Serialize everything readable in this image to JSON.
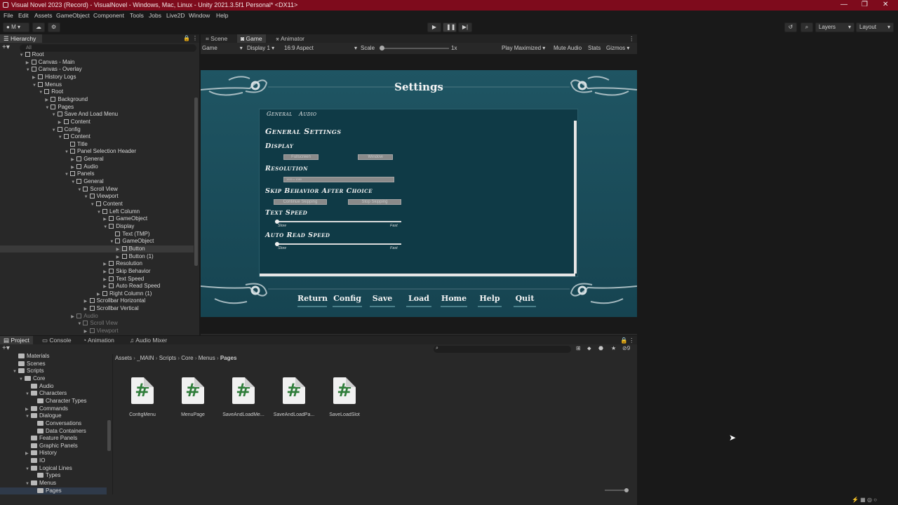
{
  "window": {
    "title": "Visual Novel 2023 (Record) - VisualNovel - Windows, Mac, Linux - Unity 2021.3.5f1 Personal* <DX11>",
    "minimize": "—",
    "restore": "❐",
    "close": "✕"
  },
  "menu": [
    "File",
    "Edit",
    "Assets",
    "GameObject",
    "Component",
    "Tools",
    "Jobs",
    "Live2D",
    "Window",
    "Help"
  ],
  "toolbar": {
    "account": "M",
    "play_icon": "play-icon",
    "pause_icon": "pause-icon",
    "step_icon": "step-icon",
    "layers": "Layers",
    "layout": "Layout"
  },
  "hierarchy": {
    "tab": "Hierarchy",
    "search_placeholder": "All",
    "rows": [
      {
        "label": "Root",
        "depth": 3,
        "arrow": "▼",
        "cut": true
      },
      {
        "label": "Canvas - Main",
        "depth": 4,
        "arrow": "▶"
      },
      {
        "label": "Canvas - Overlay",
        "depth": 4,
        "arrow": "▼"
      },
      {
        "label": "History Logs",
        "depth": 5,
        "arrow": "▶"
      },
      {
        "label": "Menus",
        "depth": 5,
        "arrow": "▼"
      },
      {
        "label": "Root",
        "depth": 6,
        "arrow": "▼"
      },
      {
        "label": "Background",
        "depth": 7,
        "arrow": "▶"
      },
      {
        "label": "Pages",
        "depth": 7,
        "arrow": "▼"
      },
      {
        "label": "Save And Load Menu",
        "depth": 8,
        "arrow": "▼"
      },
      {
        "label": "Content",
        "depth": 9,
        "arrow": "▶"
      },
      {
        "label": "Config",
        "depth": 8,
        "arrow": "▼"
      },
      {
        "label": "Content",
        "depth": 9,
        "arrow": "▼"
      },
      {
        "label": "Title",
        "depth": 10,
        "arrow": ""
      },
      {
        "label": "Panel Selection Header",
        "depth": 10,
        "arrow": "▼"
      },
      {
        "label": "General",
        "depth": 11,
        "arrow": "▶"
      },
      {
        "label": "Audio",
        "depth": 11,
        "arrow": "▶"
      },
      {
        "label": "Panels",
        "depth": 10,
        "arrow": "▼"
      },
      {
        "label": "General",
        "depth": 11,
        "arrow": "▼"
      },
      {
        "label": "Scroll View",
        "depth": 12,
        "arrow": "▼"
      },
      {
        "label": "Viewport",
        "depth": 13,
        "arrow": "▼"
      },
      {
        "label": "Content",
        "depth": 14,
        "arrow": "▼"
      },
      {
        "label": "Left Column",
        "depth": 15,
        "arrow": "▼"
      },
      {
        "label": "GameObject",
        "depth": 16,
        "arrow": "▶"
      },
      {
        "label": "Display",
        "depth": 16,
        "arrow": "▼"
      },
      {
        "label": "Text (TMP)",
        "depth": 17,
        "arrow": ""
      },
      {
        "label": "GameObject",
        "depth": 17,
        "arrow": "▼"
      },
      {
        "label": "Button",
        "depth": 18,
        "arrow": "▶",
        "sel": true
      },
      {
        "label": "Button (1)",
        "depth": 18,
        "arrow": "▶"
      },
      {
        "label": "Resolution",
        "depth": 16,
        "arrow": "▶"
      },
      {
        "label": "Skip Behavior",
        "depth": 16,
        "arrow": "▶"
      },
      {
        "label": "Text Speed",
        "depth": 16,
        "arrow": "▶"
      },
      {
        "label": "Auto Read Speed",
        "depth": 16,
        "arrow": "▶"
      },
      {
        "label": "Right Column (1)",
        "depth": 15,
        "arrow": "▶"
      },
      {
        "label": "Scrollbar Horizontal",
        "depth": 13,
        "arrow": "▶"
      },
      {
        "label": "Scrollbar Vertical",
        "depth": 13,
        "arrow": "▶"
      },
      {
        "label": "Audio",
        "depth": 11,
        "arrow": "▶",
        "dim": true
      },
      {
        "label": "Scroll View",
        "depth": 12,
        "arrow": "▼",
        "dim": true
      },
      {
        "label": "Viewport",
        "depth": 13,
        "arrow": "▶",
        "dim": true,
        "cut": true
      }
    ]
  },
  "gameview": {
    "tabs": [
      "Scene",
      "Game",
      "Animator"
    ],
    "active_tab": "Game",
    "mode": "Game",
    "display": "Display 1",
    "aspect": "16:9 Aspect",
    "scale_label": "Scale",
    "scale_value": "1x",
    "play_maximized": "Play Maximized",
    "mute": "Mute Audio",
    "stats": "Stats",
    "gizmos": "Gizmos"
  },
  "game": {
    "title": "Settings",
    "tabs": [
      "General",
      "Audio"
    ],
    "heading": "General Settings",
    "sections": [
      {
        "label": "Display",
        "buttons": [
          "Fullscreen",
          "Window"
        ]
      },
      {
        "label": "Resolution",
        "dropdown": "1920 x 1080"
      },
      {
        "label": "Skip Behavior After Choice",
        "buttons": [
          "Continue Skipping",
          "Stop Skipping"
        ]
      },
      {
        "label": "Text Speed",
        "slow": "Slow",
        "fast": "Fast"
      },
      {
        "label": "Auto Read Speed",
        "slow": "Slow",
        "fast": "Fast"
      }
    ],
    "nav": [
      "Return",
      "Config",
      "Save",
      "Load",
      "Home",
      "Help",
      "Quit"
    ]
  },
  "project": {
    "tabs": [
      "Project",
      "Console",
      "Animation",
      "Audio Mixer"
    ],
    "breadcrumb": [
      "Assets",
      "_MAIN",
      "Scripts",
      "Core",
      "Menus",
      "Pages"
    ],
    "hidden_count": "9",
    "tree": [
      {
        "label": "Materials",
        "depth": 2,
        "arrow": ""
      },
      {
        "label": "Scenes",
        "depth": 2,
        "arrow": ""
      },
      {
        "label": "Scripts",
        "depth": 2,
        "arrow": "▼"
      },
      {
        "label": "Core",
        "depth": 3,
        "arrow": "▼"
      },
      {
        "label": "Audio",
        "depth": 4,
        "arrow": ""
      },
      {
        "label": "Characters",
        "depth": 4,
        "arrow": "▼"
      },
      {
        "label": "Character Types",
        "depth": 5,
        "arrow": ""
      },
      {
        "label": "Commands",
        "depth": 4,
        "arrow": "▶"
      },
      {
        "label": "Dialogue",
        "depth": 4,
        "arrow": "▼"
      },
      {
        "label": "Conversations",
        "depth": 5,
        "arrow": ""
      },
      {
        "label": "Data Containers",
        "depth": 5,
        "arrow": ""
      },
      {
        "label": "Feature Panels",
        "depth": 4,
        "arrow": ""
      },
      {
        "label": "Graphic Panels",
        "depth": 4,
        "arrow": ""
      },
      {
        "label": "History",
        "depth": 4,
        "arrow": "▶"
      },
      {
        "label": "IO",
        "depth": 4,
        "arrow": ""
      },
      {
        "label": "Logical Lines",
        "depth": 4,
        "arrow": "▼"
      },
      {
        "label": "Types",
        "depth": 5,
        "arrow": ""
      },
      {
        "label": "Menus",
        "depth": 4,
        "arrow": "▼"
      },
      {
        "label": "Pages",
        "depth": 5,
        "arrow": "",
        "sel": true
      }
    ],
    "assets": [
      "ConfigMenu",
      "MenuPage",
      "SaveAndLoadMe...",
      "SaveAndLoadPa...",
      "SaveLoadSlot"
    ]
  }
}
